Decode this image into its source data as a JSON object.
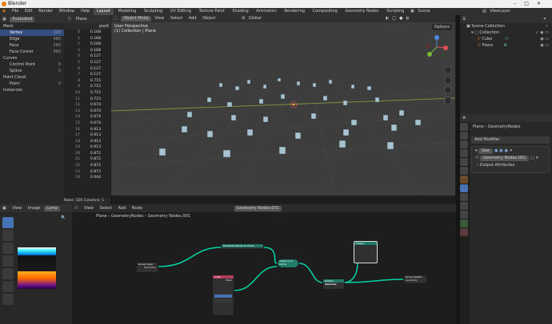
{
  "window": {
    "title": "Blender"
  },
  "menus": [
    "File",
    "Edit",
    "Render",
    "Window",
    "Help"
  ],
  "workspaces": [
    "Layout",
    "Modeling",
    "Sculpting",
    "UV Editing",
    "Texture Paint",
    "Shading",
    "Animation",
    "Rendering",
    "Compositing",
    "Geometry Nodes",
    "Scripting"
  ],
  "active_workspace": "Layout",
  "scene": {
    "name": "Scene",
    "view_layer": "ViewLayer"
  },
  "spreadsheet": {
    "mode": "Evaluated",
    "object": "Plane",
    "tree": [
      {
        "label": "Mesh",
        "count": ""
      },
      {
        "label": "Vertex",
        "count": "320"
      },
      {
        "label": "Edge",
        "count": "480"
      },
      {
        "label": "Face",
        "count": "240"
      },
      {
        "label": "Face Corner",
        "count": "960"
      },
      {
        "label": "Curves",
        "count": ""
      },
      {
        "label": "Control Point",
        "count": "0"
      },
      {
        "label": "Spline",
        "count": "0"
      },
      {
        "label": "Point Cloud",
        "count": ""
      },
      {
        "label": "Point",
        "count": "0"
      },
      {
        "label": "Instances",
        "count": ""
      }
    ],
    "column_header": "posit",
    "rows": [
      [
        "0",
        "0.168"
      ],
      [
        "1",
        "0.168"
      ],
      [
        "2",
        "0.168"
      ],
      [
        "3",
        "0.168"
      ],
      [
        "4",
        "0.127"
      ],
      [
        "5",
        "0.127"
      ],
      [
        "6",
        "0.127"
      ],
      [
        "7",
        "0.127"
      ],
      [
        "8",
        "0.715"
      ],
      [
        "9",
        "0.715"
      ],
      [
        "10",
        "0.715"
      ],
      [
        "11",
        "0.715"
      ],
      [
        "12",
        "0.674"
      ],
      [
        "13",
        "0.674"
      ],
      [
        "14",
        "0.674"
      ],
      [
        "15",
        "0.674"
      ],
      [
        "16",
        "0.913"
      ],
      [
        "17",
        "0.913"
      ],
      [
        "18",
        "0.913"
      ],
      [
        "19",
        "0.913"
      ],
      [
        "20",
        "0.872"
      ],
      [
        "21",
        "0.872"
      ],
      [
        "22",
        "0.872"
      ],
      [
        "23",
        "0.872"
      ],
      [
        "24",
        "0.044"
      ]
    ],
    "footer": {
      "rows": "Rows: 320",
      "columns": "Columns: 1"
    }
  },
  "viewport": {
    "mode": "Object Mode",
    "menus": [
      "View",
      "Select",
      "Add",
      "Object"
    ],
    "transform": "Global",
    "label_line1": "User Perspective",
    "label_line2": "(1) Collection | Plane",
    "options": "Options"
  },
  "outliner": {
    "root": "Scene Collection",
    "items": [
      {
        "label": "Collection"
      },
      {
        "label": "Cube"
      },
      {
        "label": "Plane"
      }
    ]
  },
  "properties": {
    "object": "Plane",
    "modifier_path": "GeometryNodes",
    "add_modifier": "Add Modifier",
    "modifier_short": "Geo",
    "node_group": "Geometry Nodes.001",
    "output_attributes": "Output Attributes"
  },
  "image_editor": {
    "menus": [
      "View",
      "Image"
    ],
    "name": "Luma"
  },
  "node_editor": {
    "menus": [
      "View",
      "Select",
      "Add",
      "Node"
    ],
    "node_group": "Geometry Nodes.001",
    "breadcrumb": [
      "Plane",
      "GeometryNodes",
      "Geometry Nodes.001"
    ],
    "nodes": [
      {
        "title": "Group Input",
        "socket": "Geometry"
      },
      {
        "title": "Distribute Points on Faces",
        "socket": ""
      },
      {
        "title": "Instance on Points",
        "socket": ""
      },
      {
        "title": "Realize Instances",
        "socket": "Geometry"
      },
      {
        "title": "Cube",
        "socket": "Mesh"
      },
      {
        "title": "Group Output",
        "socket": "Geometry"
      },
      {
        "title": "Viewer",
        "socket": ""
      }
    ]
  },
  "colors": {
    "accent": "#4772b3",
    "geometry_link": "#00d6a3",
    "selection": "#334d80"
  }
}
